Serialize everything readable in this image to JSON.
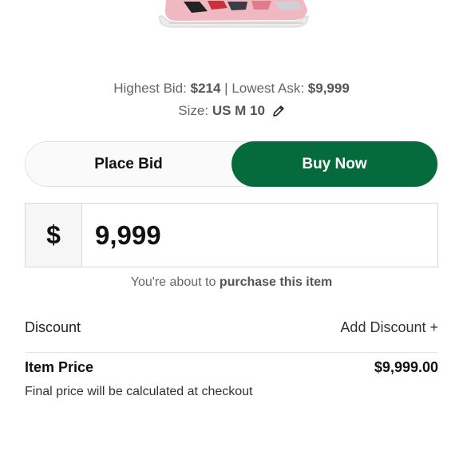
{
  "product": {
    "image_icon": "sneaker-icon"
  },
  "market": {
    "highest_bid_label": "Highest Bid:",
    "highest_bid_value": "$214",
    "separator": "|",
    "lowest_ask_label": "Lowest Ask:",
    "lowest_ask_value": "$9,999",
    "size_label": "Size:",
    "size_value": "US M 10",
    "edit_icon": "pencil-icon"
  },
  "toggle": {
    "place_bid_label": "Place Bid",
    "buy_now_label": "Buy Now",
    "selected": "Buy Now",
    "accent_color": "#056b3d"
  },
  "price_input": {
    "currency_symbol": "$",
    "value": "9,999"
  },
  "notice": {
    "prefix": "You're about to",
    "emphasis": "purchase this item"
  },
  "discount": {
    "label": "Discount",
    "action": "Add Discount +"
  },
  "item_price": {
    "label": "Item Price",
    "value": "$9,999.00"
  },
  "final_note": "Final price will be calculated at checkout"
}
